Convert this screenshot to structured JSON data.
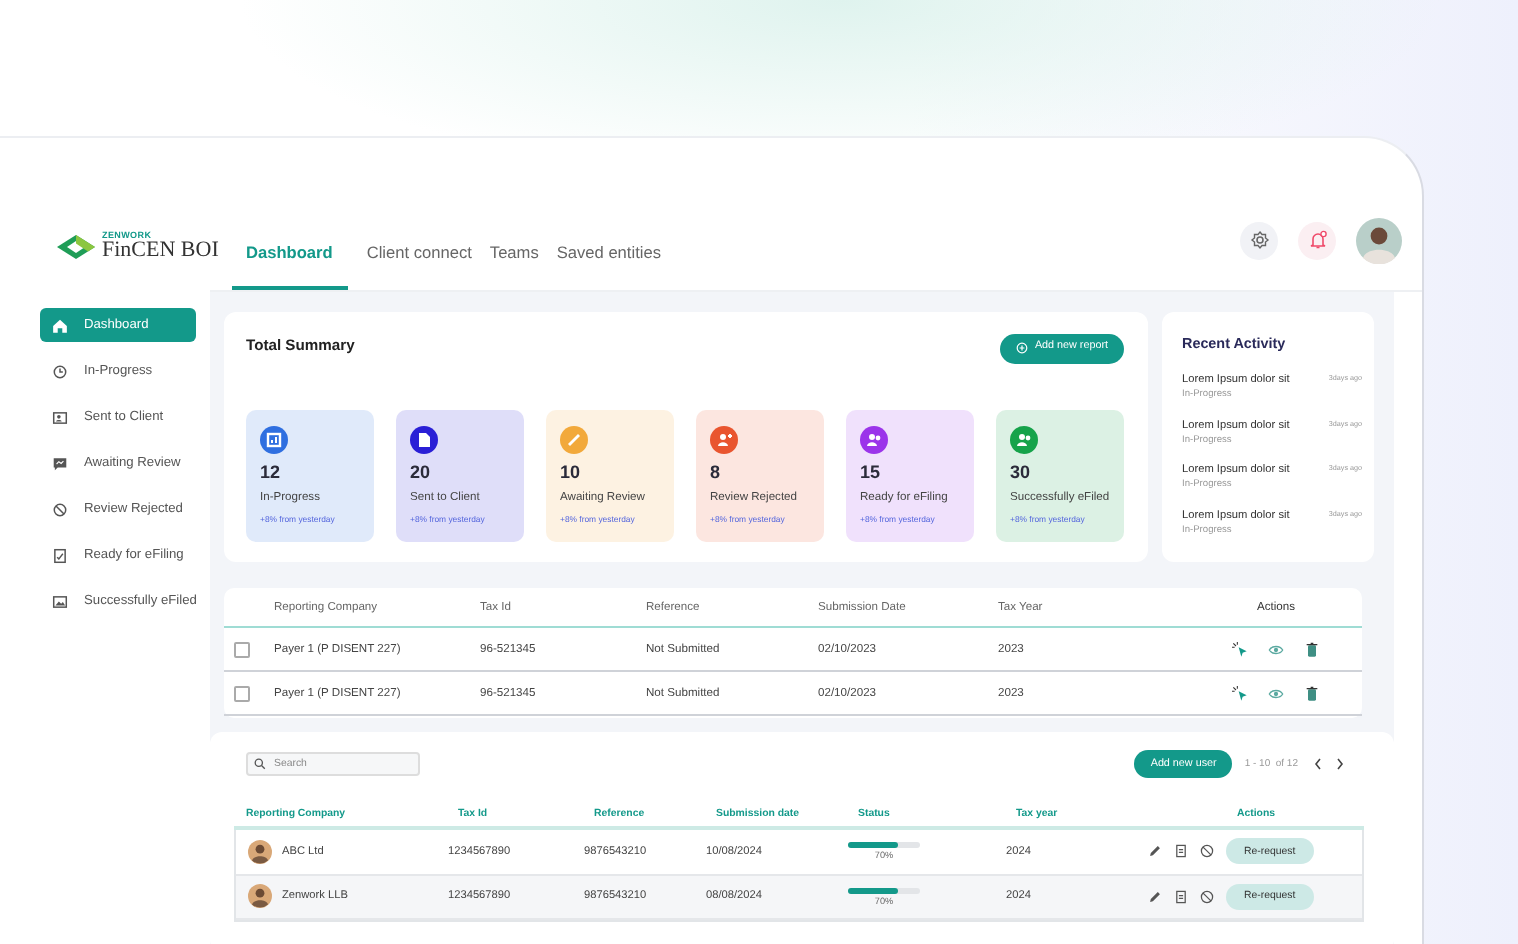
{
  "logo": {
    "brand": "ZENWORK",
    "product": "FinCEN BOI"
  },
  "tabs": [
    {
      "label": "Dashboard",
      "selected": true
    },
    {
      "label": "Client connect",
      "selected": false
    },
    {
      "label": "Teams",
      "selected": false
    },
    {
      "label": "Saved entities",
      "selected": false
    }
  ],
  "sidebar": {
    "items": [
      {
        "label": "Dashboard",
        "selected": true
      },
      {
        "label": "In-Progress",
        "selected": false
      },
      {
        "label": "Sent to Client",
        "selected": false
      },
      {
        "label": "Awaiting Review",
        "selected": false
      },
      {
        "label": "Review Rejected",
        "selected": false
      },
      {
        "label": "Ready for eFiling",
        "selected": false
      },
      {
        "label": "Successfully eFiled",
        "selected": false
      }
    ]
  },
  "summary": {
    "title": "Total Summary",
    "add_button": "Add new report",
    "stats": [
      {
        "value": "12",
        "label": "In-Progress",
        "change": "+8% from yesterday",
        "color": "#2f6fe0"
      },
      {
        "value": "20",
        "label": "Sent to Client",
        "change": "+8% from yesterday",
        "color": "#2a1fd6"
      },
      {
        "value": "10",
        "label": "Awaiting Review",
        "change": "+8% from yesterday",
        "color": "#f2a93b"
      },
      {
        "value": "8",
        "label": "Review Rejected",
        "change": "+8% from yesterday",
        "color": "#e9552f"
      },
      {
        "value": "15",
        "label": "Ready for eFiling",
        "change": "+8% from yesterday",
        "color": "#9b34ea"
      },
      {
        "value": "30",
        "label": "Successfully eFiled",
        "change": "+8% from yesterday",
        "color": "#16a34a"
      }
    ]
  },
  "activity": {
    "title": "Recent Activity",
    "items": [
      {
        "title": "Lorem Ipsum dolor sit",
        "status": "In-Progress",
        "time": "3days ago"
      },
      {
        "title": "Lorem Ipsum dolor sit",
        "status": "In-Progress",
        "time": "3days ago"
      },
      {
        "title": "Lorem Ipsum dolor sit",
        "status": "In-Progress",
        "time": "3days ago"
      },
      {
        "title": "Lorem Ipsum dolor sit",
        "status": "In-Progress",
        "time": "3days ago"
      }
    ]
  },
  "reports": {
    "columns": [
      "Reporting Company",
      "Tax Id",
      "Reference",
      "Submission Date",
      "Tax Year",
      "Actions"
    ],
    "rows": [
      {
        "checked": false,
        "company": "Payer 1 (P DISENT 227)",
        "tax_id": "96-521345",
        "reference": "Not Submitted",
        "submission_date": "02/10/2023",
        "tax_year": "2023"
      },
      {
        "checked": false,
        "company": "Payer 1 (P DISENT 227)",
        "tax_id": "96-521345",
        "reference": "Not Submitted",
        "submission_date": "02/10/2023",
        "tax_year": "2023"
      }
    ]
  },
  "users": {
    "search": {
      "placeholder": "Search"
    },
    "add_button": "Add new user",
    "pagination": "1 - 10  of 12",
    "columns": [
      "Reporting Company",
      "Tax Id",
      "Reference",
      "Submission date",
      "Status",
      "Tax year",
      "Actions"
    ],
    "rows": [
      {
        "company": "ABC Ltd",
        "tax_id": "1234567890",
        "reference": "9876543210",
        "submission_date": "10/08/2024",
        "level": 0.7,
        "status": "70%",
        "tax_year": "2024",
        "action": "Re-request"
      },
      {
        "company": "Zenwork LLB",
        "tax_id": "1234567890",
        "reference": "9876543210",
        "submission_date": "08/08/2024",
        "level": 0.7,
        "status": "70%",
        "tax_year": "2024",
        "action": "Re-request"
      }
    ]
  }
}
